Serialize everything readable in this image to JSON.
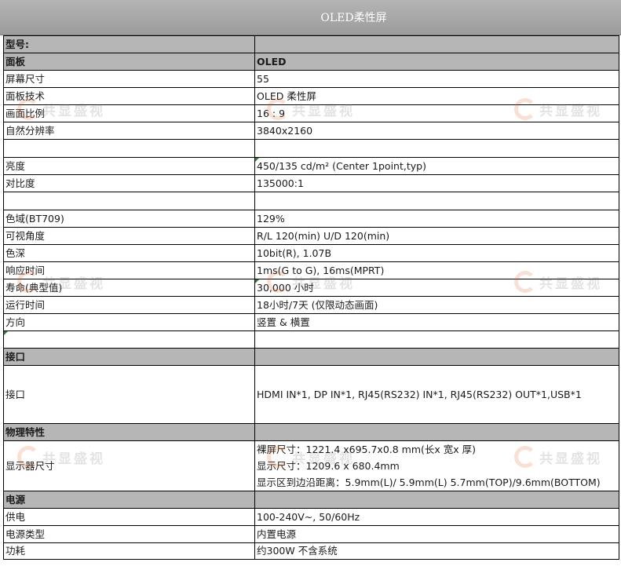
{
  "header": {
    "title": "OLED柔性屏"
  },
  "rows": [
    {
      "label": "型号:",
      "value": "",
      "section": true
    },
    {
      "label": "面板",
      "value": "OLED",
      "section": true
    },
    {
      "label": "屏幕尺寸",
      "value": "55"
    },
    {
      "label": "面板技术",
      "value": "OLED  柔性屏"
    },
    {
      "label": "画面比例",
      "value": "16 : 9"
    },
    {
      "label": "自然分辨率",
      "value": "3840x2160"
    },
    {
      "label": "",
      "value": ""
    },
    {
      "label": "亮度",
      "value": "450/135 cd/m²  (Center 1point,typ)"
    },
    {
      "label": "对比度",
      "value": "135000:1"
    },
    {
      "label": "",
      "value": ""
    },
    {
      "label": "色域(BT709)",
      "value": "129%"
    },
    {
      "label": "可视角度",
      "value": "R/L 120(min)   U/D 120(min)"
    },
    {
      "label": "色深",
      "value": "10bit(R), 1.07B"
    },
    {
      "label": "响应时间",
      "value": "1ms(G to G), 16ms(MPRT)"
    },
    {
      "label": "寿命(典型值)",
      "value": "30,000 小时"
    },
    {
      "label": "运行时间",
      "value": "18小时/7天 (仅限动态画面)"
    },
    {
      "label": "方向",
      "value": "竖置 & 横置"
    },
    {
      "label": "",
      "value": ""
    },
    {
      "label": "接口",
      "value": "",
      "section": true
    },
    {
      "label": "接口",
      "value": "HDMI  IN*1, DP IN*1,   RJ45(RS232)  IN*1, RJ45(RS232)  OUT*1,USB*1",
      "tall": true
    },
    {
      "label": "物理特性",
      "value": "",
      "section": true
    },
    {
      "label": "显示器尺寸",
      "value_lines": [
        "裸屏尺寸：1221.4 x695.7x0.8 mm(长x 宽x 厚)",
        "显示尺寸：1209.6 x  680.4mm",
        "显示区到边沿距离：5.9mm(L)/ 5.9mm(L) 5.7mm(TOP)/9.6mm(BOTTOM)"
      ]
    },
    {
      "label": "电源",
      "value": "",
      "section": true
    },
    {
      "label": "供电",
      "value": "100-240V~,  50/60Hz"
    },
    {
      "label": "电源类型",
      "value": "内置电源"
    },
    {
      "label": "功耗",
      "value": "约300W  不含系统"
    }
  ],
  "watermark": {
    "text": "共显盛视",
    "color": "#e05a1a"
  }
}
